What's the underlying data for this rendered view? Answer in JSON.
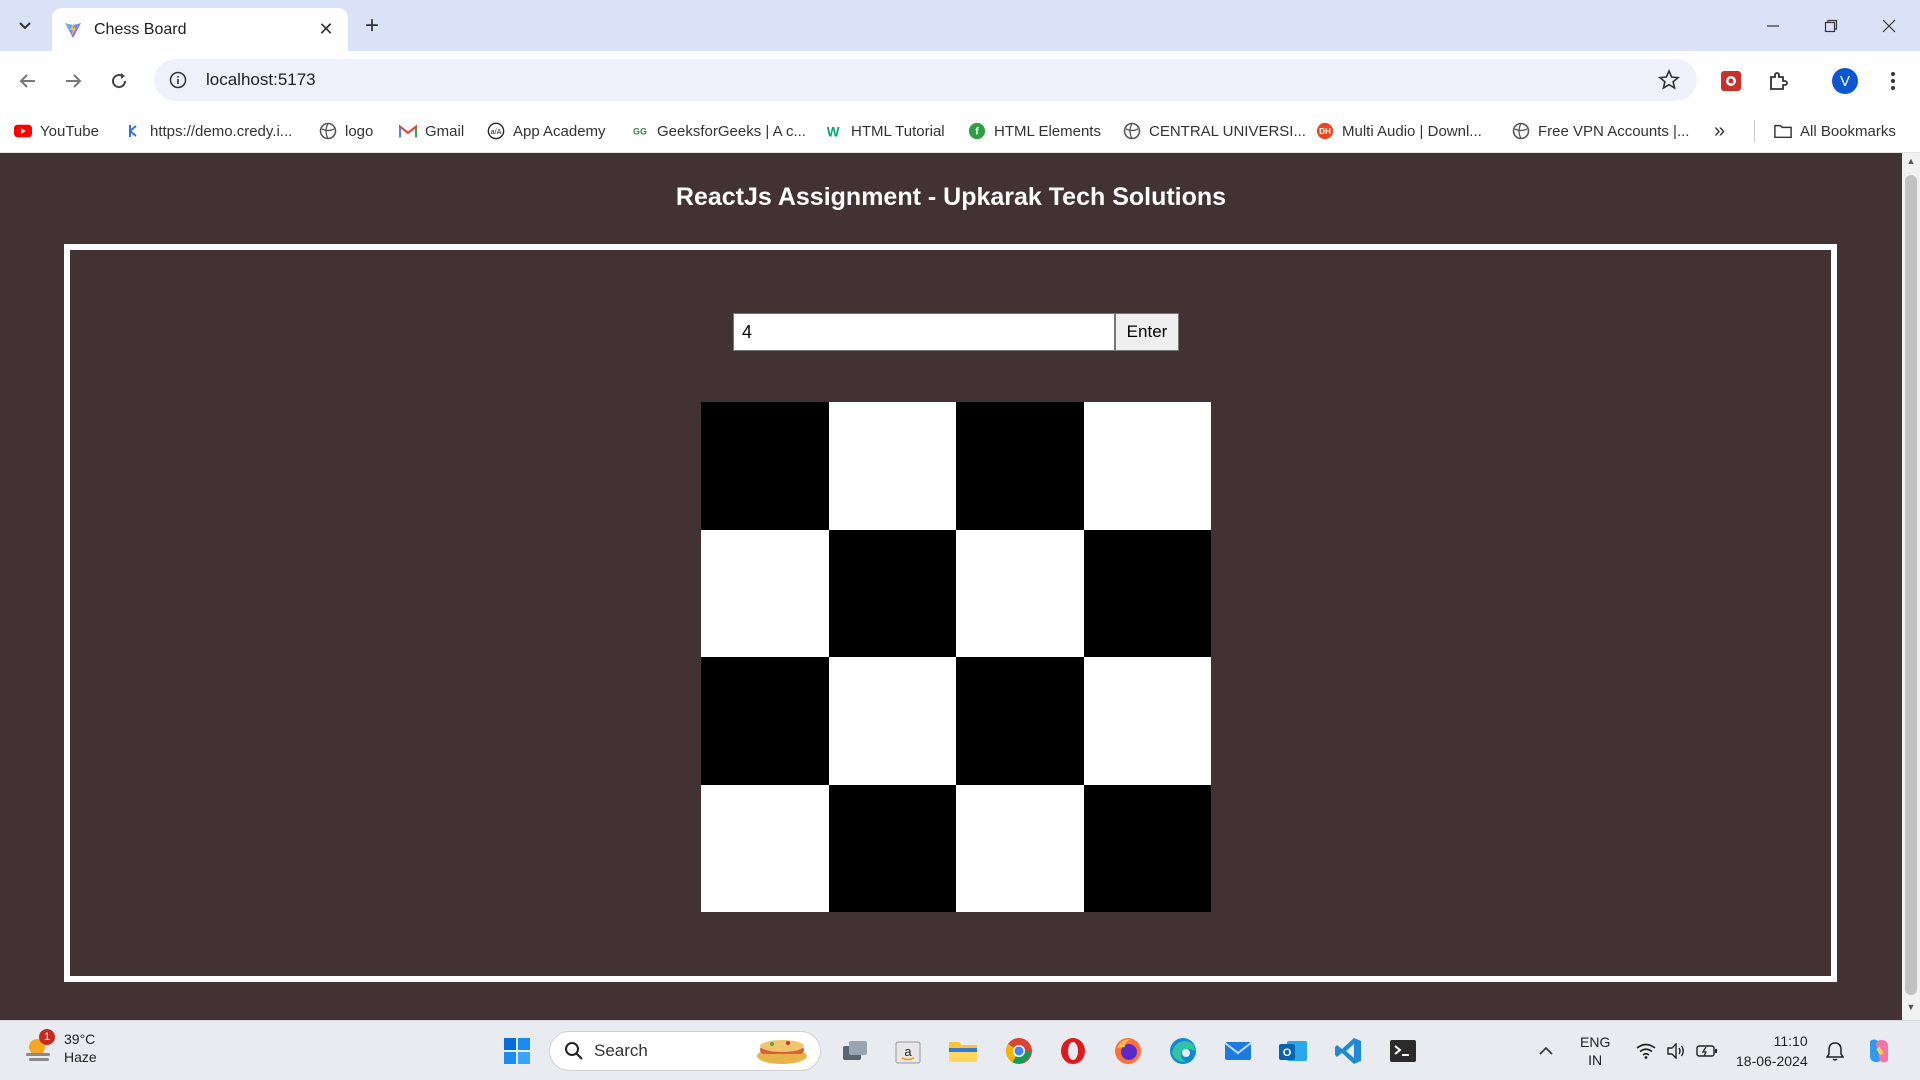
{
  "browser": {
    "tab": {
      "title": "Chess Board"
    },
    "address": {
      "url": "localhost:5173"
    },
    "profile_initial": "V",
    "bookmarks": [
      {
        "label": "YouTube",
        "icon": "youtube-icon"
      },
      {
        "label": "https://demo.credy.i...",
        "icon": "credy-icon"
      },
      {
        "label": "logo",
        "icon": "globe-icon"
      },
      {
        "label": "Gmail",
        "icon": "gmail-icon"
      },
      {
        "label": "App Academy",
        "icon": "app-academy-icon"
      },
      {
        "label": "GeeksforGeeks | A c...",
        "icon": "geeksforgeeks-icon"
      },
      {
        "label": "HTML Tutorial",
        "icon": "w3schools-icon"
      },
      {
        "label": "HTML Elements",
        "icon": "html-elements-icon"
      },
      {
        "label": "CENTRAL UNIVERSI...",
        "icon": "globe-icon"
      },
      {
        "label": "Multi Audio | Downl...",
        "icon": "multi-audio-icon"
      },
      {
        "label": "Free VPN Accounts |...",
        "icon": "globe-icon"
      }
    ],
    "more_bookmarks": "»",
    "all_bookmarks": "All Bookmarks"
  },
  "page": {
    "title": "ReactJs Assignment - Upkarak Tech Solutions",
    "input_value": "4",
    "enter_label": "Enter",
    "board_size": 4,
    "colors": {
      "dark": "#000000",
      "light": "#ffffff",
      "background": "#433233"
    }
  },
  "taskbar": {
    "weather": {
      "temp": "39°C",
      "condition": "Haze",
      "badge": "1"
    },
    "search_label": "Search",
    "lang_1": "ENG",
    "lang_2": "IN",
    "time": "11:10",
    "date": "18-06-2024"
  }
}
